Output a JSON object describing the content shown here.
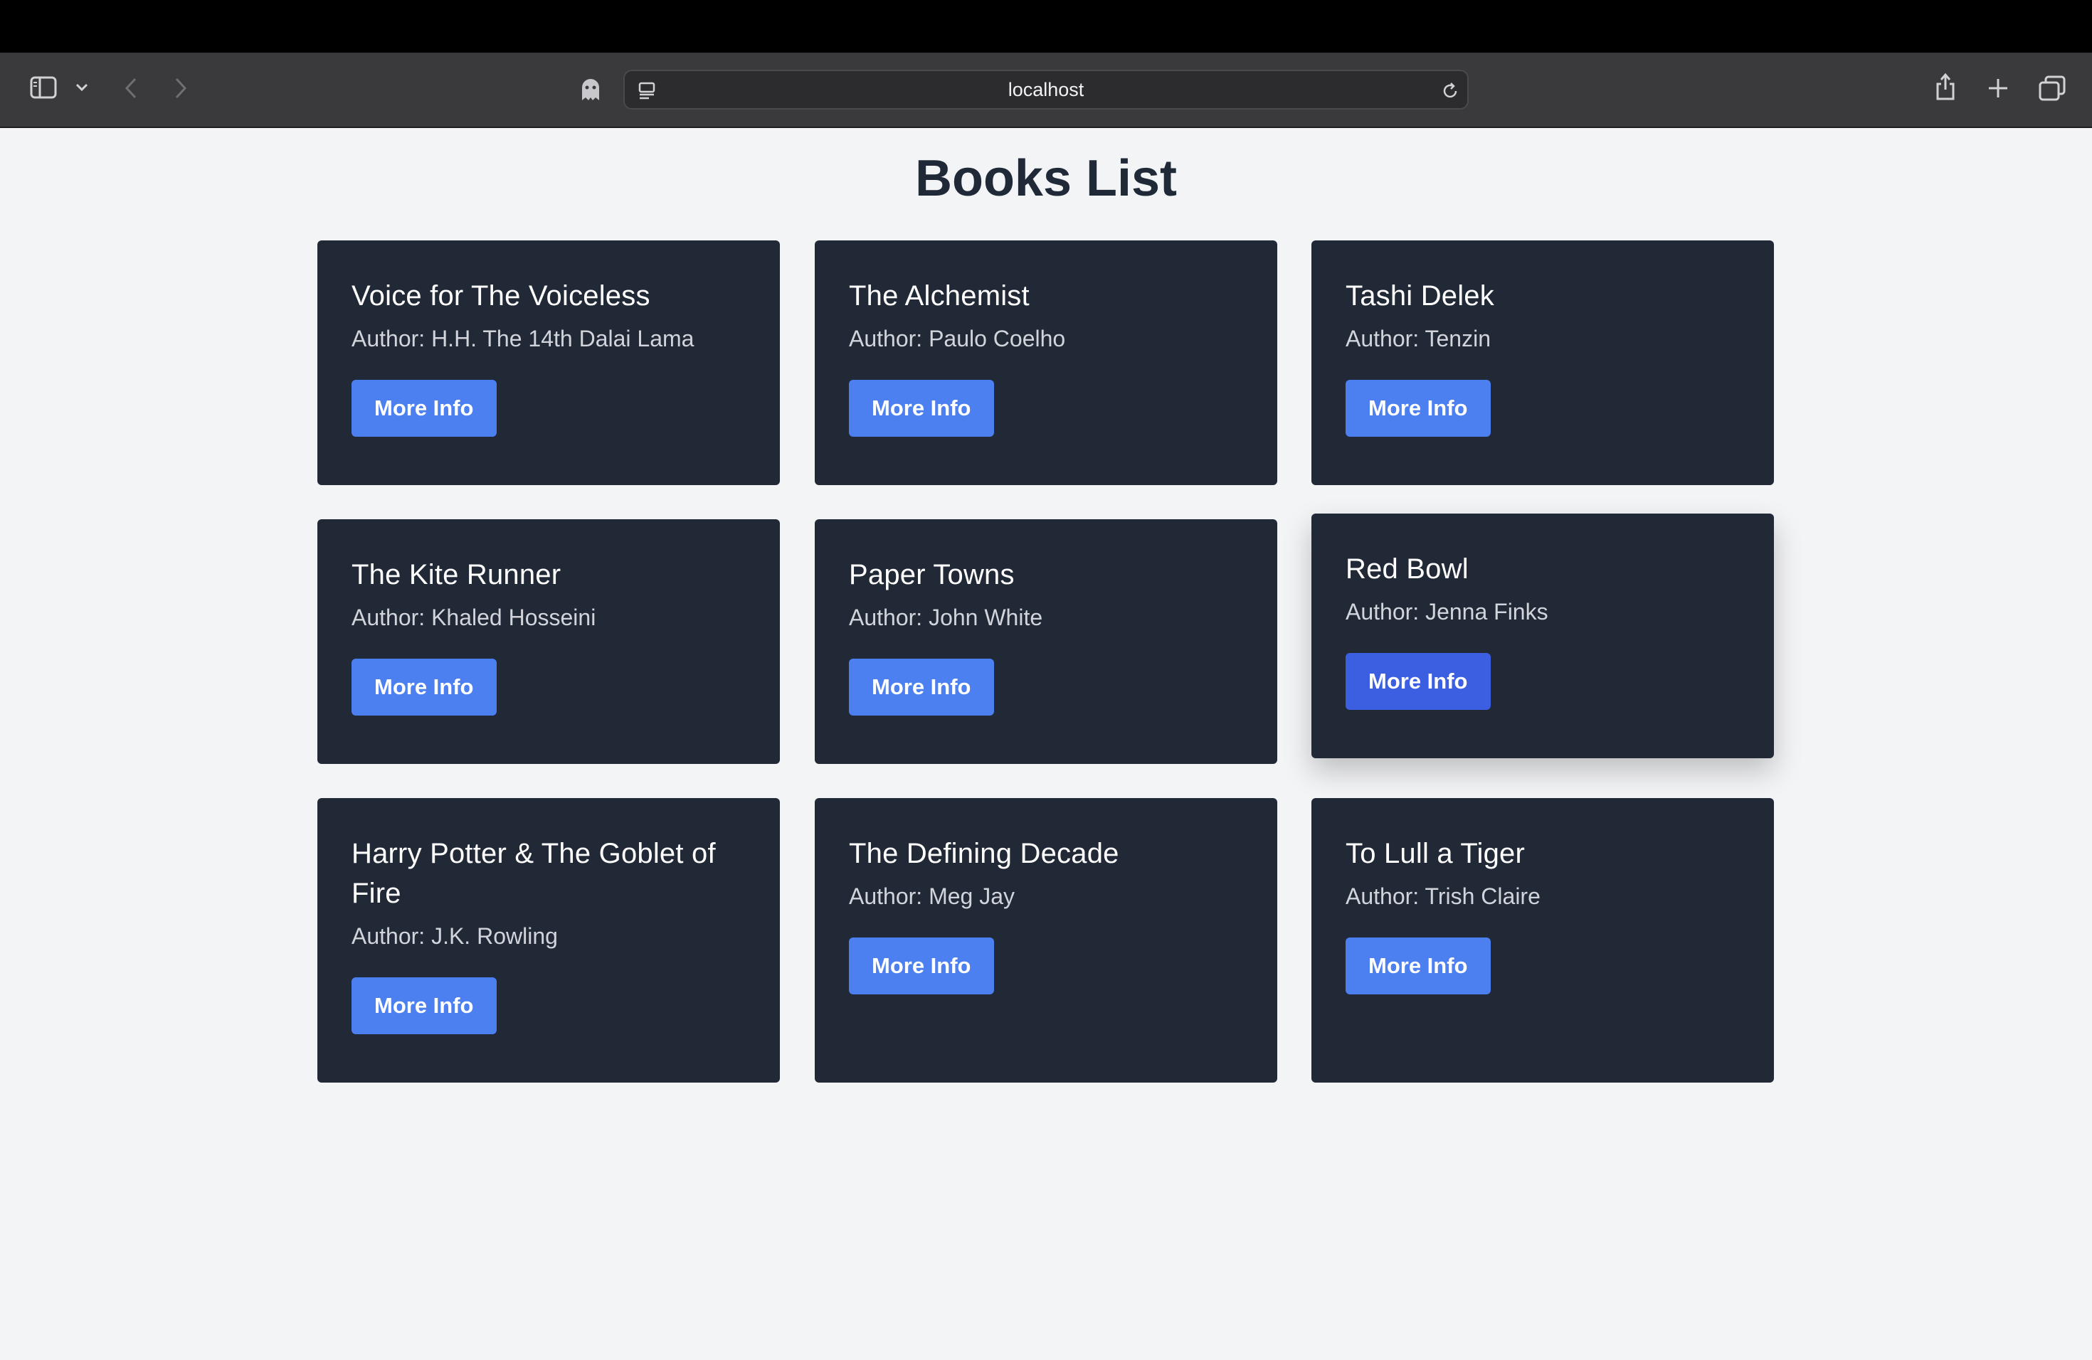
{
  "browser": {
    "address": "localhost"
  },
  "page": {
    "title": "Books List",
    "button_label": "More Info",
    "books": [
      {
        "title": "Voice for The Voiceless",
        "author": "Author: H.H. The 14th Dalai Lama"
      },
      {
        "title": "The Alchemist",
        "author": "Author: Paulo Coelho"
      },
      {
        "title": "Tashi Delek",
        "author": "Author: Tenzin"
      },
      {
        "title": "The Kite Runner",
        "author": "Author: Khaled Hosseini"
      },
      {
        "title": "Paper Towns",
        "author": "Author: John White"
      },
      {
        "title": "Red Bowl",
        "author": "Author: Jenna Finks"
      },
      {
        "title": "Harry Potter & The Goblet of Fire",
        "author": "Author: J.K. Rowling"
      },
      {
        "title": "The Defining Decade",
        "author": "Author: Meg Jay"
      },
      {
        "title": "To Lull a Tiger",
        "author": "Author: Trish Claire"
      }
    ]
  },
  "colors": {
    "card_bg": "#212836",
    "button": "#4c7ff0",
    "button_hover": "#3b5fe0",
    "page_bg": "#f3f4f6"
  }
}
